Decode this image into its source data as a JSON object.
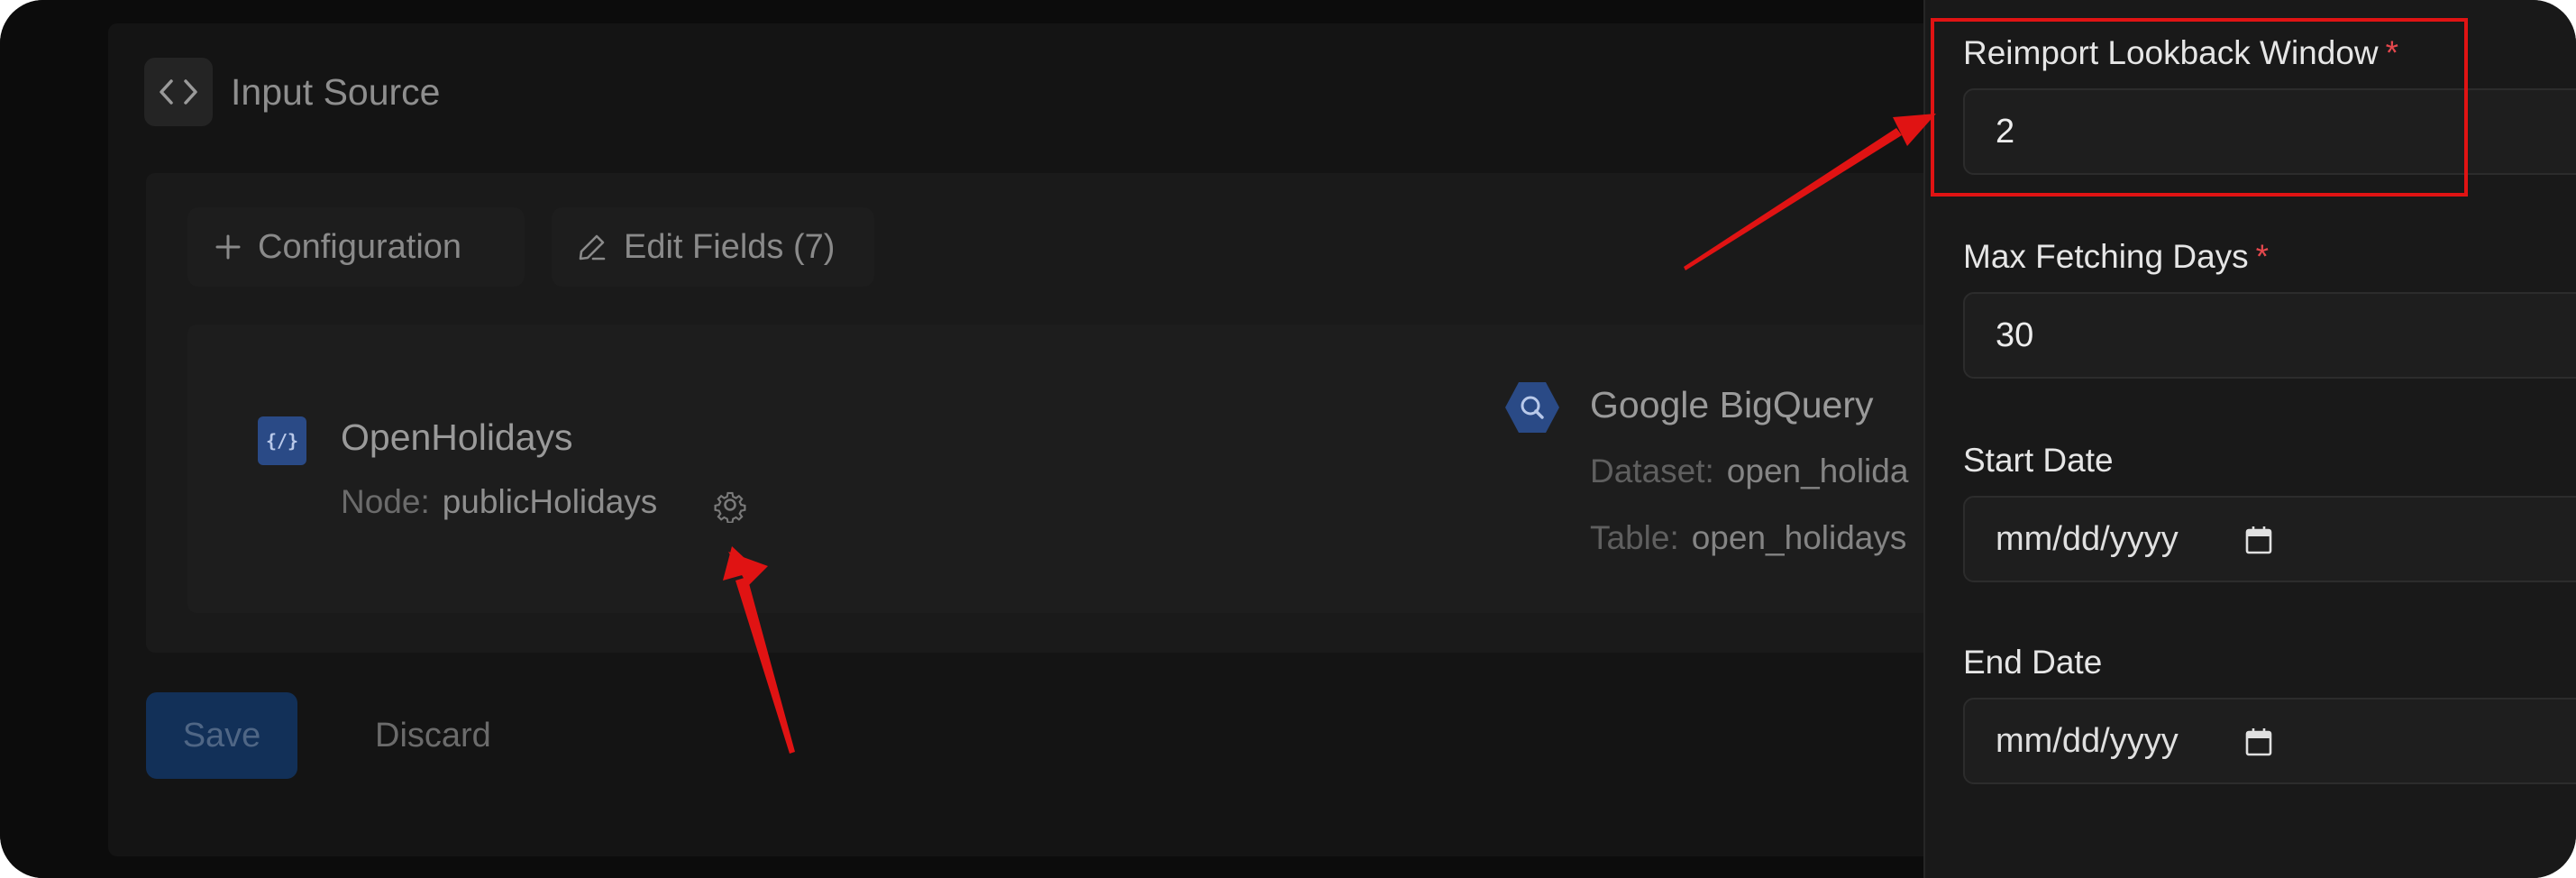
{
  "header": {
    "title": "Input Source",
    "icon": "code-brackets-icon"
  },
  "tabs": {
    "configuration_label": "Configuration",
    "edit_fields_label": "Edit Fields (7)"
  },
  "source": {
    "name": "OpenHolidays",
    "icon_text": "{/}",
    "node_label": "Node:",
    "node_value": "publicHolidays"
  },
  "destination": {
    "name": "Google BigQuery",
    "dataset_label": "Dataset:",
    "dataset_value": "open_holida",
    "table_label": "Table:",
    "table_value": "open_holidays"
  },
  "actions": {
    "save_label": "Save",
    "discard_label": "Discard"
  },
  "panel": {
    "reimport": {
      "label": "Reimport Lookback Window",
      "required": "*",
      "value": "2"
    },
    "max_fetch": {
      "label": "Max Fetching Days",
      "required": "*",
      "value": "30"
    },
    "start_date": {
      "label": "Start Date",
      "placeholder": "mm/dd/yyyy"
    },
    "end_date": {
      "label": "End Date",
      "placeholder": "mm/dd/yyyy"
    }
  },
  "colors": {
    "accent_blue": "#2a4a86",
    "required_red": "#e5484d",
    "annotation_red": "#e01313"
  }
}
